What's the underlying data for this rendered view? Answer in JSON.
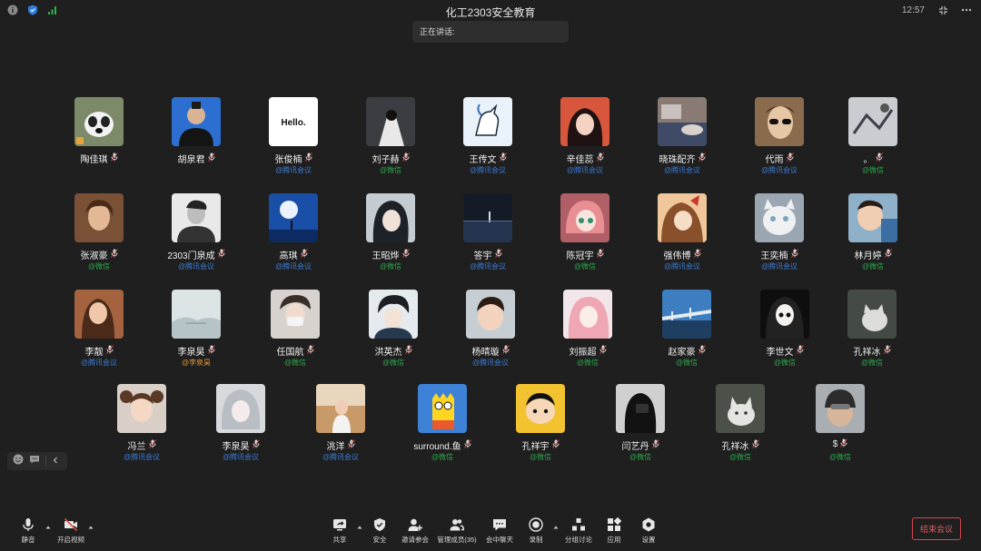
{
  "meeting": {
    "title": "化工2303安全教育",
    "time": "12:57",
    "speaking_label": "正在讲话:"
  },
  "colors": {
    "background": "#1f1f1f",
    "tencent_source": "#3a7bd5",
    "wechat_source": "#29a94a",
    "self_source": "#e0902c",
    "end_button": "#e45a5f"
  },
  "participants": [
    {
      "name": "陶佳琪",
      "source": "",
      "src_type": "none",
      "avatar": "dog-icon"
    },
    {
      "name": "胡泉君",
      "source": "",
      "src_type": "none",
      "avatar": "person-photo"
    },
    {
      "name": "张俊楠",
      "source": "@腾讯会议",
      "src_type": "tx",
      "avatar": "hello-text-avatar"
    },
    {
      "name": "刘子赫",
      "source": "@微信",
      "src_type": "wx",
      "avatar": "dark-figure"
    },
    {
      "name": "王传文",
      "source": "@腾讯会议",
      "src_type": "tx",
      "avatar": "unicorn-icon"
    },
    {
      "name": "辛佳蕊",
      "source": "@腾讯会议",
      "src_type": "tx",
      "avatar": "girl-photo"
    },
    {
      "name": "晓珠配齐",
      "source": "@腾讯会议",
      "src_type": "tx",
      "avatar": "room-photo"
    },
    {
      "name": "代雨",
      "source": "@腾讯会议",
      "src_type": "tx",
      "avatar": "sunglasses-photo"
    },
    {
      "name": "。",
      "source": "@微信",
      "src_type": "wx",
      "avatar": "sketch-photo"
    },
    {
      "name": "张淑豪",
      "source": "@微信",
      "src_type": "wx",
      "avatar": "portrait-warm"
    },
    {
      "name": "2303门泉成",
      "source": "@腾讯会议",
      "src_type": "tx",
      "avatar": "bw-portrait"
    },
    {
      "name": "高琪",
      "source": "@腾讯会议",
      "src_type": "tx",
      "avatar": "moon-night"
    },
    {
      "name": "王昭烨",
      "source": "@微信",
      "src_type": "wx",
      "avatar": "anime-girl"
    },
    {
      "name": "答宇",
      "source": "@腾讯会议",
      "src_type": "tx",
      "avatar": "night-sea"
    },
    {
      "name": "陈冠宇",
      "source": "@微信",
      "src_type": "wx",
      "avatar": "anime-pink"
    },
    {
      "name": "强伟博",
      "source": "@腾讯会议",
      "src_type": "tx",
      "avatar": "anime-butterfly"
    },
    {
      "name": "王奕楠",
      "source": "@腾讯会议",
      "src_type": "tx",
      "avatar": "white-cat"
    },
    {
      "name": "林月婷",
      "source": "@微信",
      "src_type": "wx",
      "avatar": "baby-photo"
    },
    {
      "name": "李靓",
      "source": "@腾讯会议",
      "src_type": "tx",
      "avatar": "woman-photo"
    },
    {
      "name": "李泉昊",
      "source": "@李泉昊",
      "src_type": "me",
      "avatar": "mist-landscape"
    },
    {
      "name": "任国航",
      "source": "@微信",
      "src_type": "wx",
      "avatar": "boy-mask"
    },
    {
      "name": "洪英杰",
      "source": "@微信",
      "src_type": "wx",
      "avatar": "anime-boy"
    },
    {
      "name": "杨晴璇",
      "source": "@腾讯会议",
      "src_type": "tx",
      "avatar": "child-photo"
    },
    {
      "name": "刘振超",
      "source": "@微信",
      "src_type": "wx",
      "avatar": "anime-pink-hair"
    },
    {
      "name": "赵家豪",
      "source": "@微信",
      "src_type": "wx",
      "avatar": "bridge-photo"
    },
    {
      "name": "李世文",
      "source": "@微信",
      "src_type": "wx",
      "avatar": "anime-dark"
    },
    {
      "name": "孔祥冰",
      "source": "@微信",
      "src_type": "wx",
      "avatar": "cat-photo"
    },
    {
      "name": "冯兰",
      "source": "@腾讯会议",
      "src_type": "tx",
      "avatar": "girl-pigtails"
    },
    {
      "name": "李泉昊",
      "source": "@腾讯会议",
      "src_type": "tx",
      "avatar": "anime-silver"
    },
    {
      "name": "洮洋",
      "source": "@腾讯会议",
      "src_type": "tx",
      "avatar": "girl-room"
    },
    {
      "name": "surround.鱼",
      "source": "@微信",
      "src_type": "wx",
      "avatar": "bart-cartoon"
    },
    {
      "name": "孔祥宇",
      "source": "@微信",
      "src_type": "wx",
      "avatar": "crayon-cartoon"
    },
    {
      "name": "闫艺丹",
      "source": "@微信",
      "src_type": "wx",
      "avatar": "dark-selfie"
    },
    {
      "name": "孔祥冰",
      "source": "@微信",
      "src_type": "wx",
      "avatar": "cat-photo-2"
    },
    {
      "name": "$",
      "source": "@微信",
      "src_type": "wx",
      "avatar": "helmet-photo"
    }
  ],
  "toolbar": {
    "mute": "静音",
    "video": "开启视频",
    "share": "共享",
    "security": "安全",
    "invite": "邀请参会",
    "members": "管理成员(35)",
    "chat": "会中聊天",
    "record": "录制",
    "breakout": "分组讨论",
    "apps": "应用",
    "settings": "设置",
    "end": "结束会议"
  }
}
